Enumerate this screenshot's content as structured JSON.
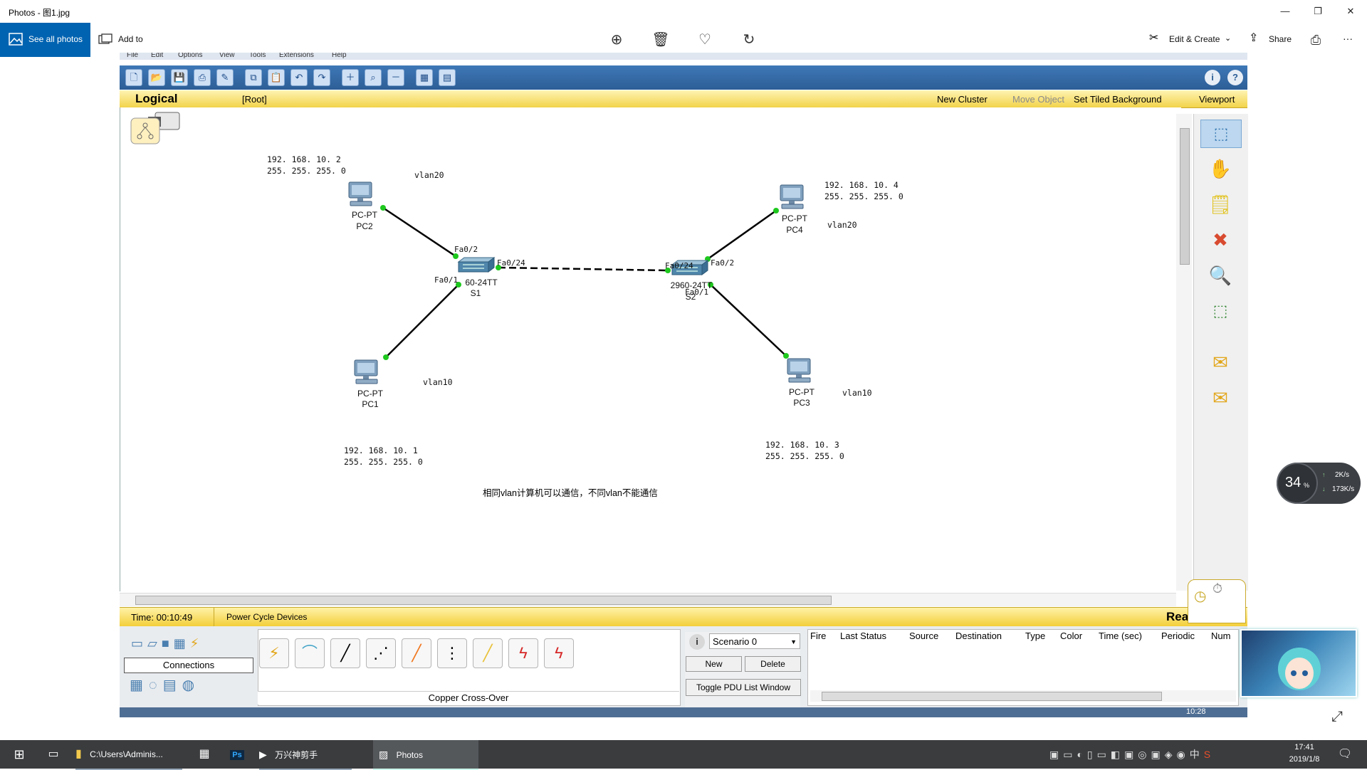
{
  "window": {
    "title": "Photos - 图1.jpg",
    "controls": [
      "—",
      "❐",
      "✕"
    ]
  },
  "photos_toolbar": {
    "see_all": "See all photos",
    "add_to": "Add to",
    "edit_create": "Edit & Create",
    "share": "Share",
    "more": "···",
    "icons": [
      "zoom-in-icon",
      "delete-icon",
      "heart-icon",
      "rotate-icon",
      "print-icon"
    ]
  },
  "pt": {
    "menu": [
      "File",
      "Edit",
      "Options",
      "View",
      "Tools",
      "Extensions",
      "Help"
    ],
    "logical": "Logical",
    "root": "[Root]",
    "new_cluster": "New Cluster",
    "move_object": "Move Object",
    "set_tiled_bg": "Set Tiled Background",
    "viewport": "Viewport",
    "time": "Time: 00:10:49",
    "power_cycle": "Power Cycle Devices",
    "realtime": "Realtime",
    "connections_label": "Connections",
    "cable_type": "Copper Cross-Over",
    "scenario": "Scenario 0",
    "new_btn": "New",
    "delete_btn": "Delete",
    "toggle_pdu": "Toggle PDU List Window",
    "pdu_columns": [
      "Fire",
      "Last Status",
      "Source",
      "Destination",
      "Type",
      "Color",
      "Time (sec)",
      "Periodic",
      "Num"
    ],
    "clock": "10:28"
  },
  "network": {
    "pc2": {
      "type": "PC-PT",
      "name": "PC2",
      "ip": "192. 168. 10. 2",
      "mask": "255. 255. 255. 0",
      "vlan": "vlan20"
    },
    "pc1": {
      "type": "PC-PT",
      "name": "PC1",
      "ip": "192. 168. 10. 1",
      "mask": "255. 255. 255. 0",
      "vlan": "vlan10"
    },
    "pc4": {
      "type": "PC-PT",
      "name": "PC4",
      "ip": "192. 168. 10. 4",
      "mask": "255. 255. 255. 0",
      "vlan": "vlan20"
    },
    "pc3": {
      "type": "PC-PT",
      "name": "PC3",
      "ip": "192. 168. 10. 3",
      "mask": "255. 255. 255. 0",
      "vlan": "vlan10"
    },
    "s1": {
      "model": "60-24TT",
      "name": "S1",
      "ports": [
        "Fa0/2",
        "Fa0/24",
        "Fa0/1"
      ]
    },
    "s2": {
      "model": "2960-24TT",
      "name": "S2",
      "ports": [
        "Fa0/24",
        "Fa0/2",
        "Fa0/1"
      ]
    },
    "note": "相同vlan计算机可以通信，不同vlan不能通信"
  },
  "netspeed": {
    "percent": "34",
    "unit": "%",
    "up": "2K/s",
    "down": "173K/s"
  },
  "taskbar": {
    "explorer": "C:\\Users\\Adminis...",
    "video_app": "万兴神剪手",
    "photos": "Photos",
    "time": "17:41",
    "date": "2019/1/8"
  },
  "colors": {
    "accent": "#0063b1",
    "pt_blue": "#2d5e96",
    "pt_yellow": "#f3cf3a",
    "link_green": "#1ec81e"
  }
}
